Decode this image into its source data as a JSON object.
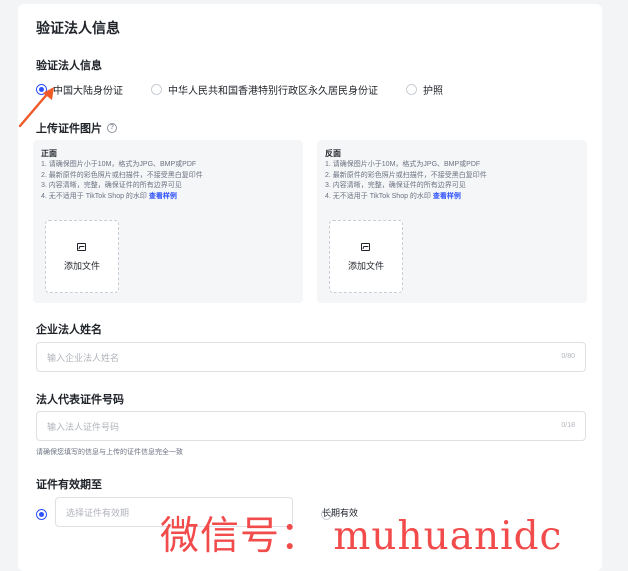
{
  "section": {
    "title": "验证法人信息"
  },
  "id_type": {
    "label": "验证法人信息",
    "options": [
      "中国大陆身份证",
      "中华人民共和国香港特别行政区永久居民身份证",
      "护照"
    ],
    "selected": "中国大陆身份证"
  },
  "upload": {
    "label": "上传证件图片",
    "help_icon": "question-circle-icon",
    "rules": [
      "1. 请确保图片小于10M，格式为JPG、BMP或PDF",
      "2. 最新原件的彩色照片或扫描件，不接受黑白复印件",
      "3. 内容清晰，完整，确保证件的所有边界可见",
      "4. 无不适用于 TikTok Shop 的水印"
    ],
    "example_link": "查看样例",
    "front": {
      "title": "正面",
      "add_label": "添加文件"
    },
    "back": {
      "title": "反面",
      "add_label": "添加文件"
    },
    "add_icon": "image-icon"
  },
  "name_field": {
    "label": "企业法人姓名",
    "placeholder": "输入企业法人姓名",
    "counter": "0/80"
  },
  "id_number_field": {
    "label": "法人代表证件号码",
    "placeholder": "输入法人证件号码",
    "counter": "0/18",
    "hint": "请确保您填写的信息与上传的证件信息完全一致"
  },
  "validity": {
    "label": "证件有效期至",
    "date_placeholder": "选择证件有效期",
    "long_term_label": "长期有效",
    "selected": "date"
  },
  "watermark": {
    "text": "微信号：  muhuanidc"
  },
  "colors": {
    "accent": "#2f52ff",
    "arrow": "#f05a28",
    "watermark": "#f24b4b"
  }
}
